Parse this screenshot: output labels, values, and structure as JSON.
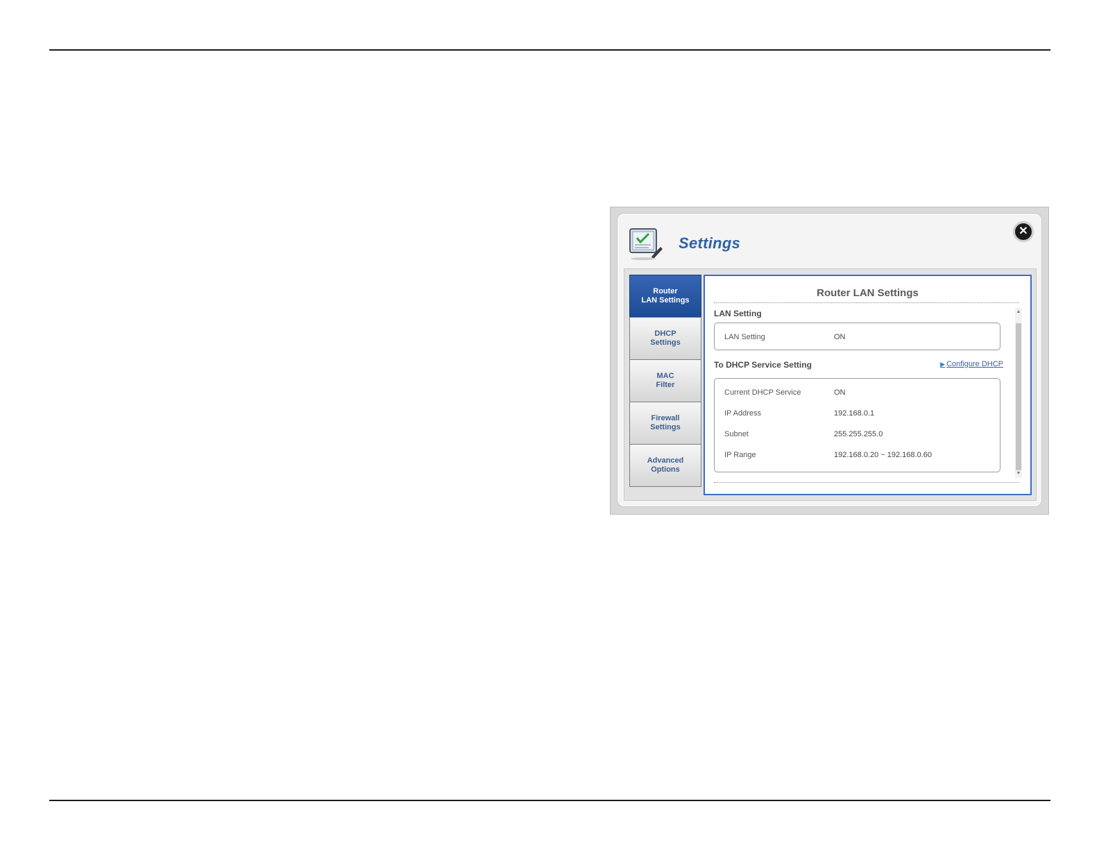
{
  "dialog": {
    "title": "Settings",
    "close_glyph": "✕",
    "header_icon": "settings-checklist-icon"
  },
  "nav": {
    "items": [
      {
        "label": "Router\nLAN Settings",
        "active": true
      },
      {
        "label": "DHCP\nSettings",
        "active": false
      },
      {
        "label": "MAC\nFilter",
        "active": false
      },
      {
        "label": "Firewall\nSettings",
        "active": false
      },
      {
        "label": "Advanced\nOptions",
        "active": false
      }
    ]
  },
  "content": {
    "title": "Router LAN Settings",
    "lan_section": {
      "label": "LAN Setting",
      "rows": [
        {
          "key": "LAN Setting",
          "value": "ON"
        }
      ]
    },
    "dhcp_section": {
      "label": "To DHCP Service Setting",
      "link_label": "Configure DHCP",
      "rows": [
        {
          "key": "Current DHCP Service",
          "value": "ON"
        },
        {
          "key": "IP Address",
          "value": "192.168.0.1"
        },
        {
          "key": "Subnet",
          "value": "255.255.255.0"
        },
        {
          "key": "IP Range",
          "value": "192.168.0.20 ~ 192.168.0.60"
        }
      ]
    }
  },
  "colors": {
    "accent": "#2f62a6",
    "nav_active": "#1f4b94",
    "content_border": "#3b6cc0"
  }
}
